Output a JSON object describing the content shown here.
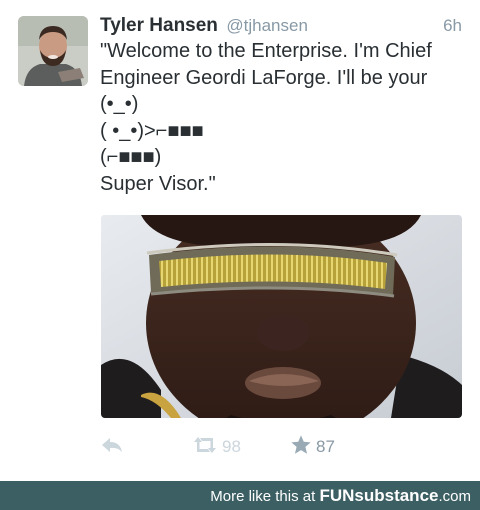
{
  "tweet": {
    "author_name": "Tyler Hansen",
    "handle": "@tjhansen",
    "time": "6h",
    "lines": [
      "\"Welcome to the Enterprise. I'm Chief",
      "Engineer Geordi LaForge. I'll be your",
      "(•_•)",
      "( •_•)>⌐■■■",
      "(⌐■■■)",
      "Super Visor.\""
    ],
    "retweet_count": "98",
    "favorite_count": "87"
  },
  "icons": {
    "reply": "reply-arrow-icon",
    "retweet": "retweet-icon",
    "favorite": "star-icon"
  },
  "colors": {
    "text": "#292f33",
    "muted": "#8899a6",
    "retweet_muted": "#ccd6dd",
    "footer_bg": "#3c5f63"
  },
  "footer": {
    "prefix": "More like this at ",
    "brand": "FUNsubstance",
    "suffix": ".com"
  }
}
